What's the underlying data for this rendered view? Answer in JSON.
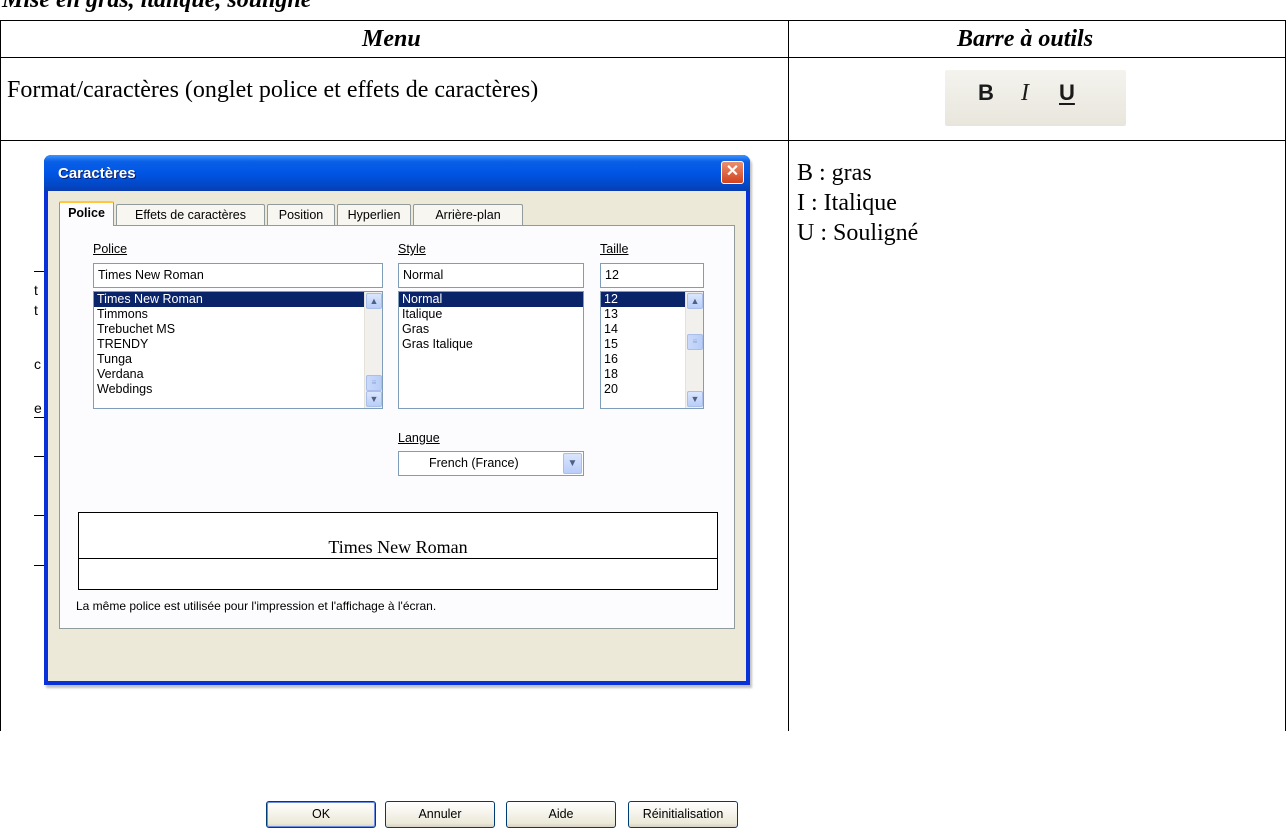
{
  "document": {
    "heading": "Mise en gras, italique, souligné",
    "table": {
      "header_menu": "Menu",
      "header_toolbar": "Barre à outils",
      "row1_menu_text": "Format/caractères (onglet police et effets de caractères)",
      "toolbar_buttons": {
        "bold": "B",
        "italic": "I",
        "underline": "U"
      },
      "notes": [
        "B : gras",
        "I : Italique",
        "U : Souligné"
      ]
    }
  },
  "dialog": {
    "title": "Caractères",
    "tabs": [
      "Police",
      "Effets de caractères",
      "Position",
      "Hyperlien",
      "Arrière-plan"
    ],
    "active_tab": "Police",
    "font_label": "Police",
    "font_value": "Times New Roman",
    "font_list": [
      "Times New Roman",
      "Timmons",
      "Trebuchet MS",
      "TRENDY",
      "Tunga",
      "Verdana",
      "Webdings"
    ],
    "style_label": "Style",
    "style_value": "Normal",
    "style_list": [
      "Normal",
      "Italique",
      "Gras",
      "Gras Italique"
    ],
    "size_label": "Taille",
    "size_value": "12",
    "size_list": [
      "12",
      "13",
      "14",
      "15",
      "16",
      "18",
      "20"
    ],
    "language_label": "Langue",
    "language_value": "French (France)",
    "preview_text": "Times New Roman",
    "info_text": "La même police est utilisée pour l'impression et l'affichage à l'écran.",
    "buttons": {
      "ok": "OK",
      "cancel": "Annuler",
      "help": "Aide",
      "reset": "Réinitialisation"
    }
  },
  "background_fragments": [
    "t",
    "t",
    "c",
    "e"
  ],
  "colors": {
    "title_bar": "#0055e5",
    "selection": "#0a246a",
    "dialog_face": "#ece9d8",
    "toolbar_strip": "#efeee7"
  },
  "icons": {
    "close": "close-icon",
    "scroll_up": "scroll-up-icon",
    "scroll_down": "scroll-down-icon",
    "combo": "chevron-down-icon"
  }
}
